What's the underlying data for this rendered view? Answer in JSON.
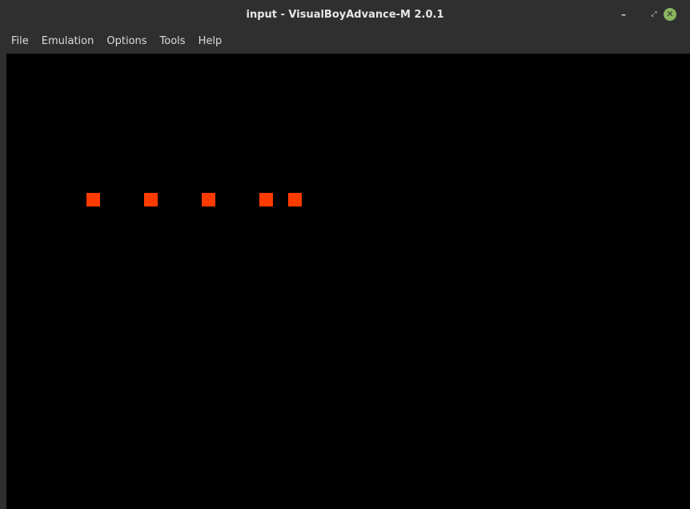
{
  "window": {
    "title": "input - VisualBoyAdvance-M 2.0.1",
    "controls": {
      "minimize": "–",
      "maximize": "⤢",
      "close": "✕"
    }
  },
  "menu": [
    "File",
    "Emulation",
    "Options",
    "Tools",
    "Help"
  ],
  "screen": {
    "background": "#000000",
    "block_color": "#ff3b00",
    "block_count": 5
  },
  "colors": {
    "titlebar": "#2f2f2f",
    "close_button": "#8ab65f"
  }
}
